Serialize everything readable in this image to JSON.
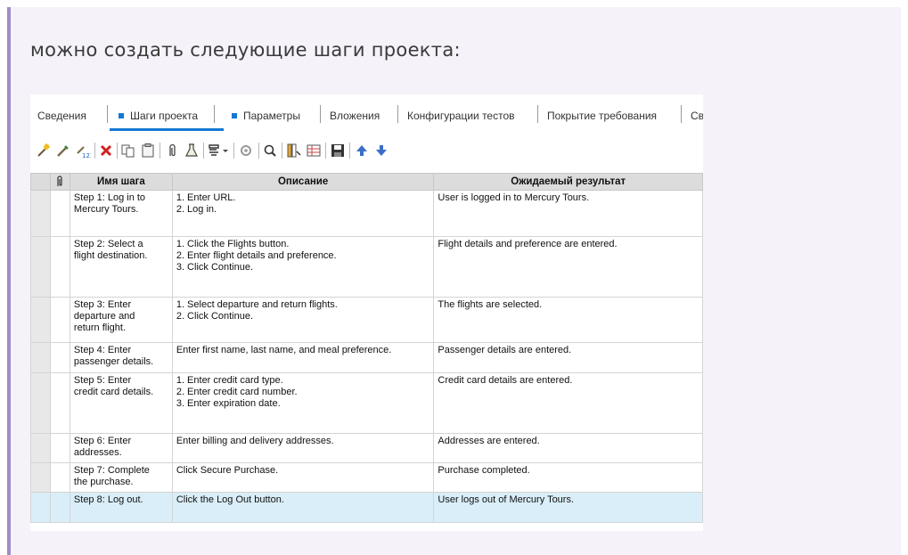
{
  "heading": "можно создать следующие шаги проекта:",
  "tabs": [
    {
      "label": "Сведения",
      "dot": false
    },
    {
      "label": "Шаги проекта",
      "dot": true,
      "active": true
    },
    {
      "label": "Параметры",
      "dot": true
    },
    {
      "label": "Вложения",
      "dot": false
    },
    {
      "label": "Конфигурации тестов",
      "dot": false
    },
    {
      "label": "Покрытие требования",
      "dot": false
    },
    {
      "label": "Св",
      "dot": false
    }
  ],
  "toolbar": [
    "new-step-icon",
    "edit-step-icon",
    "renumber-steps-icon",
    "delete-icon",
    "copy-icon",
    "paste-icon",
    "attachment-icon",
    "call-test-icon",
    "generate-script-icon",
    "parameter-icon",
    "find-icon",
    "select-columns-icon",
    "grid-filter-icon",
    "save-icon",
    "move-up-icon",
    "move-down-icon"
  ],
  "columns": {
    "attach": "",
    "name": "Имя шага",
    "description": "Описание",
    "expected": "Ожидаемый результат"
  },
  "rows": [
    {
      "name": [
        "Step 1: Log in to",
        "Mercury Tours."
      ],
      "desc": [
        "1. Enter URL.",
        "2. Log in."
      ],
      "exp": [
        "User is logged in to Mercury Tours."
      ]
    },
    {
      "name": [
        "Step 2: Select a",
        "flight destination."
      ],
      "desc": [
        "1. Click the Flights button.",
        "2. Enter flight details and preference.",
        "3. Click Continue."
      ],
      "exp": [
        "Flight details and preference are entered."
      ]
    },
    {
      "name": [
        "Step 3: Enter",
        "departure and",
        "return flight."
      ],
      "desc": [
        "1. Select departure and return flights.",
        "2. Click Continue."
      ],
      "exp": [
        "The flights are selected."
      ]
    },
    {
      "name": [
        "Step 4: Enter",
        "passenger details."
      ],
      "desc": [
        "Enter first name, last name, and meal preference."
      ],
      "exp": [
        "Passenger details are entered."
      ]
    },
    {
      "name": [
        "Step 5: Enter",
        "credit card details."
      ],
      "desc": [
        "1. Enter credit card type.",
        "2. Enter credit card number.",
        "3. Enter expiration date."
      ],
      "exp": [
        "Credit card details are entered."
      ]
    },
    {
      "name": [
        "Step 6: Enter",
        "addresses."
      ],
      "desc": [
        "Enter billing and delivery addresses."
      ],
      "exp": [
        "Addresses are entered."
      ]
    },
    {
      "name": [
        "Step 7: Complete",
        "the purchase."
      ],
      "desc": [
        "Click Secure Purchase."
      ],
      "exp": [
        "Purchase completed."
      ]
    },
    {
      "name": [
        "Step 8: Log out."
      ],
      "desc": [
        "Click the Log Out button."
      ],
      "exp": [
        "User logs out of Mercury Tours."
      ],
      "selected": true
    }
  ],
  "colors": {
    "accent": "#1478d4",
    "note_bar": "#a08cc8",
    "selected_row": "#d9eef8"
  }
}
